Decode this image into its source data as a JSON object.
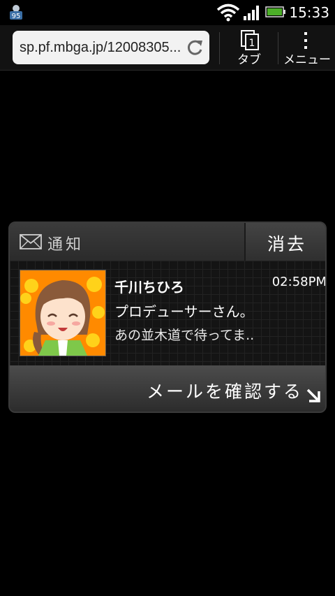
{
  "status": {
    "time": "15:33",
    "badge": "95",
    "icons": [
      "wifi-icon",
      "signal-icon",
      "battery-icon"
    ]
  },
  "browser": {
    "url": "sp.pf.mbga.jp/12008305...",
    "tab_label": "タブ",
    "tab_count": "1",
    "menu_label": "メニュー"
  },
  "notification": {
    "title": "通知",
    "clear_label": "消去",
    "sender": "千川ちひろ",
    "time": "02:58PM",
    "line1": "プロデューサーさん。",
    "line2": "あの並木道で待ってま..",
    "action_label": "メールを確認する"
  },
  "colors": {
    "accent_battery": "#4caf28",
    "avatar_bg": "#ff8a00"
  }
}
